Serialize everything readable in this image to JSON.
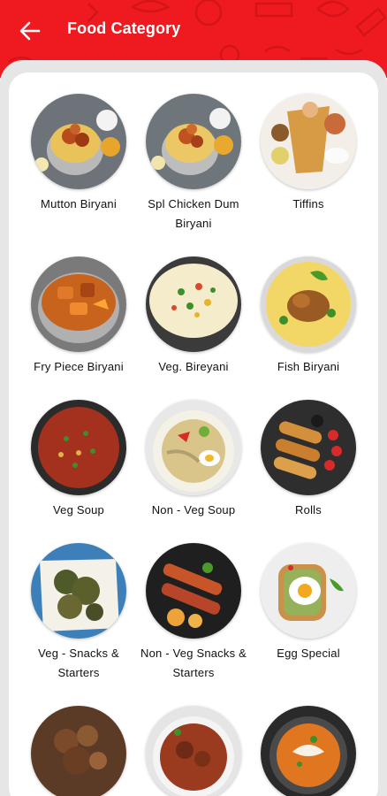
{
  "header": {
    "title": "Food Category",
    "back_icon": "arrow-left-icon",
    "background_color": "#ee1a1f"
  },
  "categories": [
    {
      "label": "Mutton Biryani",
      "image": "mutton-biryani-image"
    },
    {
      "label": "Spl Chicken Dum Biryani",
      "image": "spl-chicken-dum-biryani-image"
    },
    {
      "label": "Tiffins",
      "image": "tiffins-image"
    },
    {
      "label": "Fry Piece Biryani",
      "image": "fry-piece-biryani-image"
    },
    {
      "label": "Veg. Bireyani",
      "image": "veg-biryani-image"
    },
    {
      "label": "Fish Biryani",
      "image": "fish-biryani-image"
    },
    {
      "label": "Veg Soup",
      "image": "veg-soup-image"
    },
    {
      "label": "Non - Veg Soup",
      "image": "non-veg-soup-image"
    },
    {
      "label": "Rolls",
      "image": "rolls-image"
    },
    {
      "label": "Veg - Snacks & Starters",
      "image": "veg-snacks-image"
    },
    {
      "label": "Non - Veg Snacks & Starters",
      "image": "non-veg-snacks-image"
    },
    {
      "label": "Egg Special",
      "image": "egg-special-image"
    },
    {
      "label": "",
      "image": "mutton-curry-image"
    },
    {
      "label": "",
      "image": "chicken-curry-image"
    },
    {
      "label": "",
      "image": "butter-curry-image"
    }
  ]
}
